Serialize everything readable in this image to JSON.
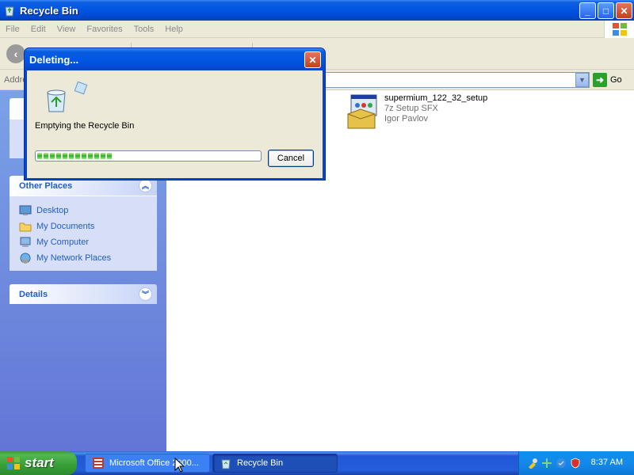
{
  "window": {
    "title": "Recycle Bin",
    "buttons": {
      "minimize": "_",
      "maximize": "□",
      "close": "✕"
    }
  },
  "menu": [
    "File",
    "Edit",
    "View",
    "Favorites",
    "Tools",
    "Help"
  ],
  "address": {
    "label": "Addre",
    "go_label": "Go"
  },
  "left_pane": {
    "other_places": {
      "title": "Other Places",
      "items": [
        "Desktop",
        "My Documents",
        "My Computer",
        "My Network Places"
      ]
    },
    "details": {
      "title": "Details"
    }
  },
  "content": {
    "file": {
      "name": "supermium_122_32_setup",
      "type": "7z Setup SFX",
      "company": "Igor Pavlov"
    }
  },
  "dialog": {
    "title": "Deleting...",
    "message": "Emptying the Recycle Bin",
    "cancel_label": "Cancel",
    "progress": 0.33
  },
  "taskbar": {
    "start_label": "start",
    "tasks": [
      "Microsoft Office 2000...",
      "Recycle Bin"
    ],
    "clock": "8:37 AM"
  },
  "colors": {
    "titlebar": "#0054e3",
    "task_pane_link": "#215dc6",
    "progress_fill": "#2bb21a"
  }
}
